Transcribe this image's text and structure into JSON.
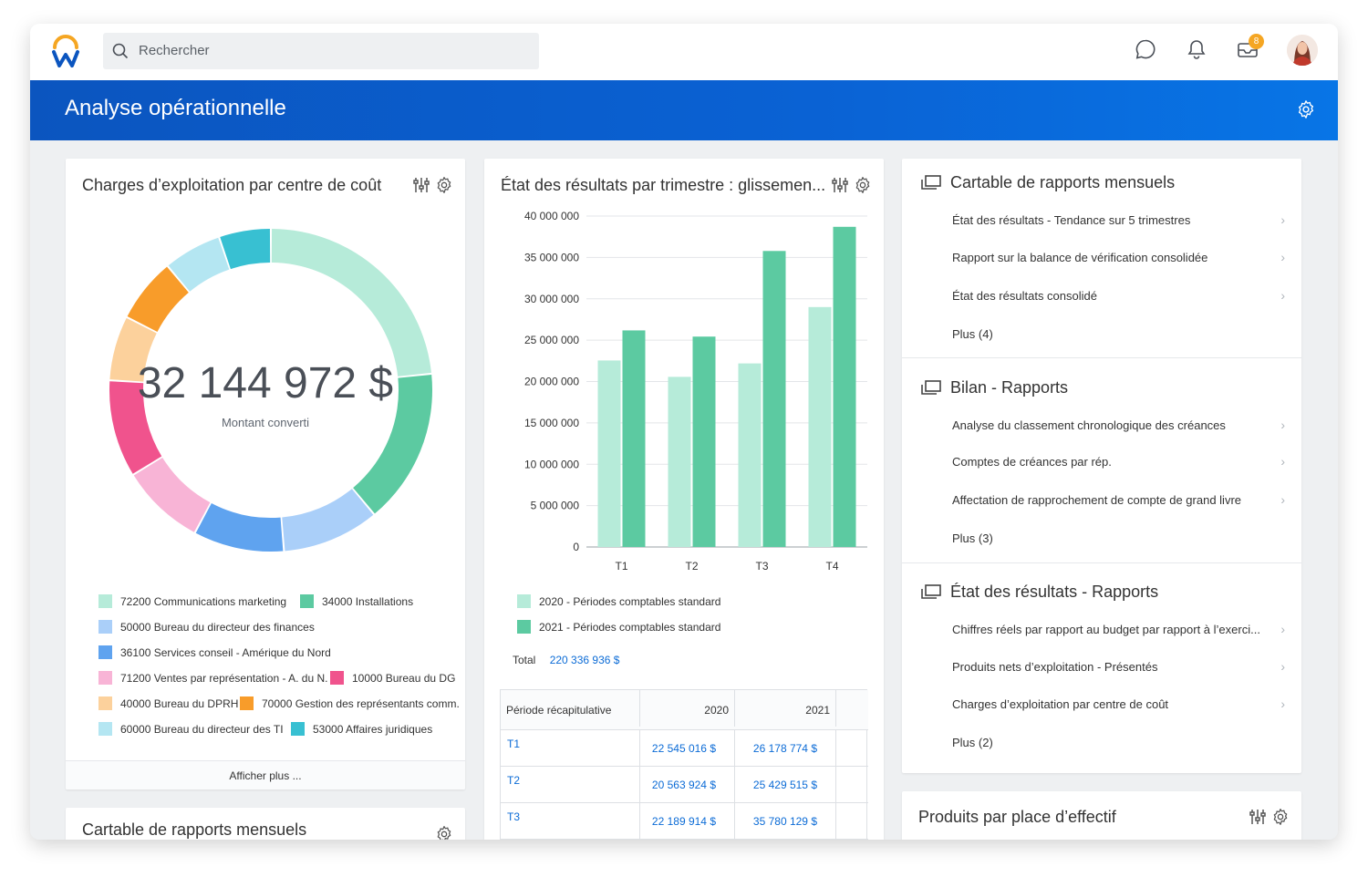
{
  "topbar": {
    "search_placeholder": "Rechercher",
    "notification_count": "8"
  },
  "banner": {
    "title": "Analyse opérationnelle"
  },
  "card1": {
    "title": "Charges d’exploitation par centre de coût",
    "center_value": "32 144 972 $",
    "center_label": "Montant converti",
    "show_more": "Afficher plus ...",
    "legend": [
      {
        "label": "72200 Communications marketing",
        "color": "#b6ebd9"
      },
      {
        "label": "34000 Installations",
        "color": "#5ccaa1"
      },
      {
        "label": "50000 Bureau du directeur des finances",
        "color": "#aacff9"
      },
      {
        "label": "36100 Services conseil - Amérique du Nord",
        "color": "#5fa3ef"
      },
      {
        "label": "71200 Ventes par représentation - A. du N.",
        "color": "#f8b4d6"
      },
      {
        "label": "10000 Bureau du DG",
        "color": "#f0538d"
      },
      {
        "label": "40000 Bureau du DPRH",
        "color": "#fcd19c"
      },
      {
        "label": "70000 Gestion des représentants comm.",
        "color": "#f89c2a"
      },
      {
        "label": "60000 Bureau du directeur des TI",
        "color": "#b4e6f2"
      },
      {
        "label": "53000 Affaires juridiques",
        "color": "#38c0d2"
      }
    ]
  },
  "card2": {
    "title": "Cartable de rapports mensuels"
  },
  "card3": {
    "title": "État des résultats par trimestre : glissemen...",
    "total_label": "Total",
    "total_value": "220 336 936 $",
    "table_headers": [
      "Période récapitulative",
      "2020",
      "2021"
    ],
    "table_rows": [
      [
        "T1",
        "22 545 016 $",
        "26 178 774 $"
      ],
      [
        "T2",
        "20 563 924 $",
        "25 429 515 $"
      ],
      [
        "T3",
        "22 189 914 $",
        "35 780 129 $"
      ]
    ]
  },
  "chart_data": {
    "type": "bar",
    "categories": [
      "T1",
      "T2",
      "T3",
      "T4"
    ],
    "series": [
      {
        "name": "2020 - Périodes comptables standard",
        "color": "#b6ebd9",
        "values": [
          22545016,
          20563924,
          22189914,
          29000000
        ]
      },
      {
        "name": "2021 - Périodes comptables standard",
        "color": "#5ccaa1",
        "values": [
          26178774,
          25429515,
          35780129,
          38700000
        ]
      }
    ],
    "ylim": [
      0,
      40000000
    ],
    "yticks": [
      "0",
      "5 000 000",
      "10 000 000",
      "15 000 000",
      "20 000 000",
      "25 000 000",
      "30 000 000",
      "35 000 000",
      "40 000 000"
    ],
    "grid": true,
    "legend_position": "bottom"
  },
  "donut_data": {
    "type": "pie",
    "values": [
      18,
      12,
      7.5,
      7,
      6.5,
      7.5,
      5,
      5,
      4.5,
      4
    ],
    "colors": [
      "#b6ebd9",
      "#5ccaa1",
      "#aacff9",
      "#5fa3ef",
      "#f8b4d6",
      "#f0538d",
      "#fcd19c",
      "#f89c2a",
      "#b4e6f2",
      "#38c0d2"
    ]
  },
  "reports": {
    "sections": [
      {
        "title": "Cartable de rapports mensuels",
        "items": [
          "État des résultats - Tendance sur 5 trimestres",
          "Rapport sur la balance de vérification consolidée",
          "État des résultats consolidé"
        ],
        "more": "Plus (4)"
      },
      {
        "title": "Bilan - Rapports",
        "items": [
          "Analyse du classement chronologique des créances",
          "Comptes de créances par rép.",
          "Affectation de rapprochement de compte de grand livre"
        ],
        "more": "Plus (3)"
      },
      {
        "title": "État des résultats - Rapports",
        "items": [
          "Chiffres réels par rapport au budget par rapport à l’exerci...",
          "Produits nets d’exploitation - Présentés",
          "Charges d’exploitation par centre de coût"
        ],
        "more": "Plus (2)"
      }
    ]
  },
  "card5": {
    "title": "Produits par place d’effectif"
  },
  "icons": {
    "chevron": "›"
  }
}
